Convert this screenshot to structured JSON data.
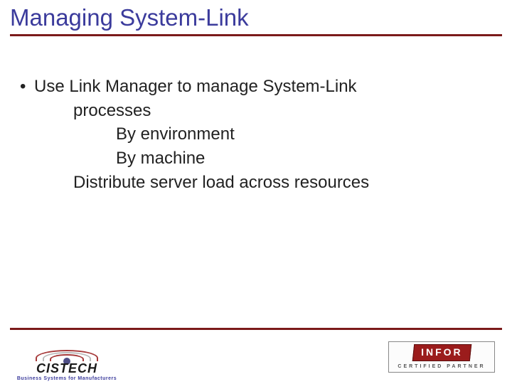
{
  "title": "Managing System-Link",
  "bullets": {
    "lvl1": "Use Link Manager to manage System-Link",
    "lvl2_a": "processes",
    "lvl3_a": "By environment",
    "lvl3_b": "By machine",
    "lvl2_b": "Distribute server load across resources"
  },
  "footer": {
    "left_brand": "CISTECH",
    "left_tag": "Business Systems for Manufacturers",
    "right_brand": "INFOR",
    "right_tag": "CERTIFIED PARTNER"
  }
}
